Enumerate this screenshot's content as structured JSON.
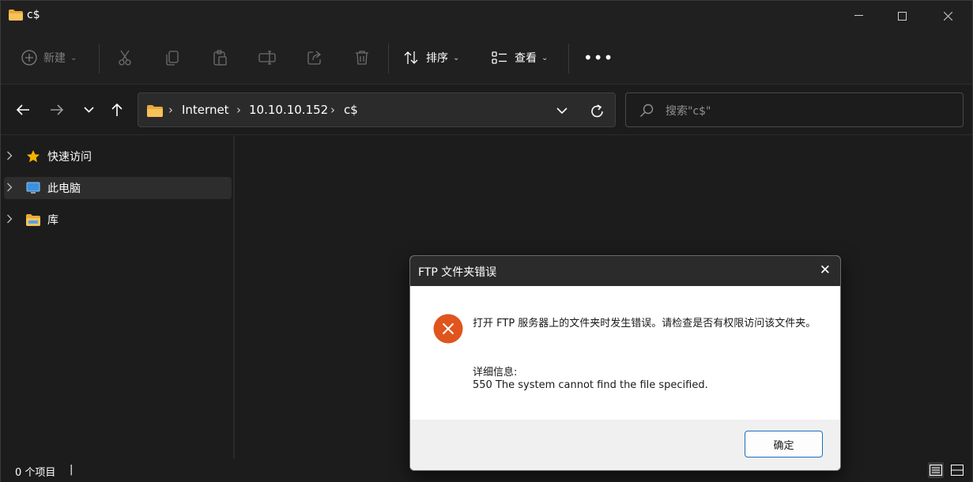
{
  "window": {
    "title": "c$",
    "minimize_icon": "minimize-icon",
    "maximize_icon": "maximize-icon",
    "close_icon": "close-icon"
  },
  "toolbar": {
    "new_label": "新建",
    "sort_label": "排序",
    "view_label": "查看",
    "more_label": "•••",
    "icons": [
      "cut-icon",
      "copy-icon",
      "paste-icon",
      "rename-icon",
      "share-icon",
      "delete-icon"
    ]
  },
  "address": {
    "crumbs": [
      "Internet",
      "10.10.10.152",
      "c$"
    ],
    "separator": "›"
  },
  "search": {
    "placeholder": "搜索\"c$\""
  },
  "sidebar": {
    "items": [
      {
        "label": "快速访问",
        "icon": "star-icon"
      },
      {
        "label": "此电脑",
        "icon": "computer-icon"
      },
      {
        "label": "库",
        "icon": "library-folder-icon"
      }
    ]
  },
  "status": {
    "item_count": "0 个项目",
    "cursor": "|"
  },
  "dialog": {
    "title": "FTP 文件夹错误",
    "close": "✕",
    "message": "打开 FTP 服务器上的文件夹时发生错误。请检查是否有权限访问该文件夹。",
    "details_heading": "详细信息:",
    "details": "550 The system cannot find the file specified.",
    "ok_label": "确定"
  },
  "colors": {
    "accent": "#1a6fc4",
    "error": "#e0541e",
    "folder": "#f6c35a",
    "star": "#f4b400"
  }
}
